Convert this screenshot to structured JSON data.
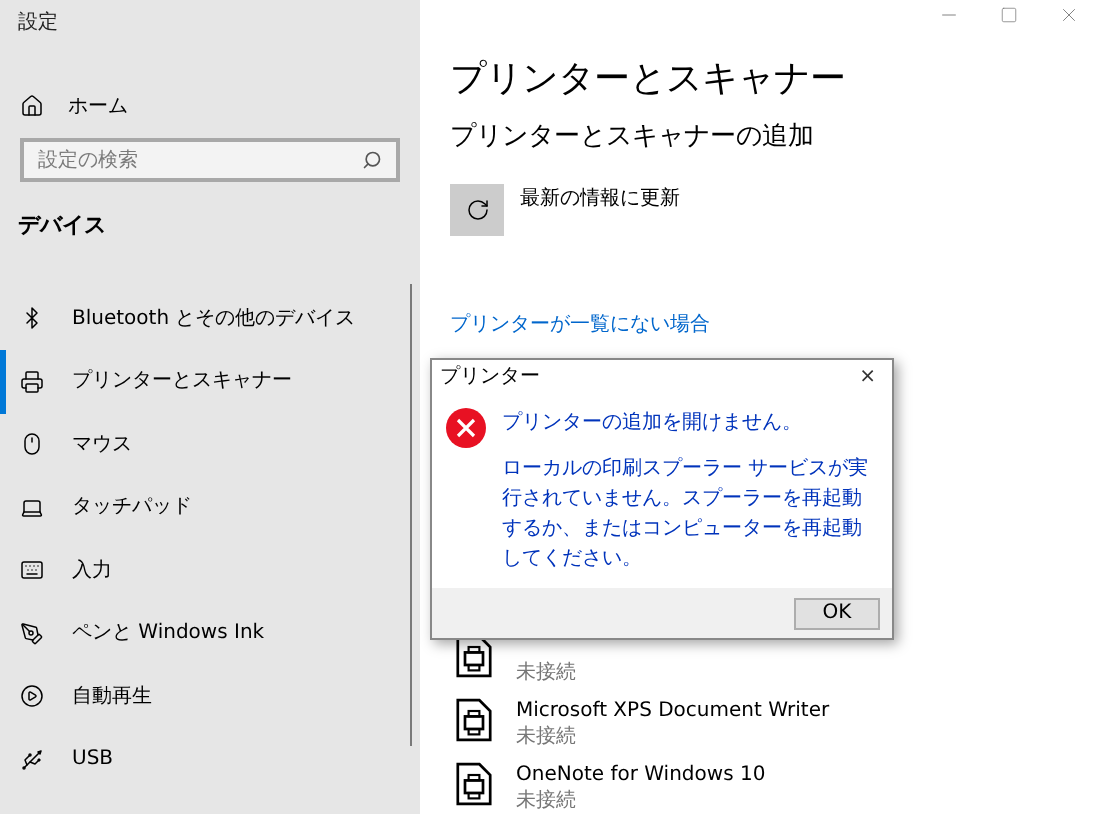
{
  "window": {
    "title": "設定"
  },
  "sidebar": {
    "home": "ホーム",
    "search": {
      "placeholder": "設定の検索"
    },
    "section": "デバイス",
    "items": [
      {
        "kind": "bluetooth",
        "label": "Bluetooth とその他のデバイス",
        "selected": false
      },
      {
        "kind": "printer",
        "label": "プリンターとスキャナー",
        "selected": true
      },
      {
        "kind": "mouse",
        "label": "マウス",
        "selected": false
      },
      {
        "kind": "touchpad",
        "label": "タッチパッド",
        "selected": false
      },
      {
        "kind": "keyboard",
        "label": "入力",
        "selected": false
      },
      {
        "kind": "pen",
        "label": "ペンと Windows Ink",
        "selected": false
      },
      {
        "kind": "autoplay",
        "label": "自動再生",
        "selected": false
      },
      {
        "kind": "usb",
        "label": "USB",
        "selected": false
      }
    ]
  },
  "main": {
    "title": "プリンターとスキャナー",
    "subtitle": "プリンターとスキャナーの追加",
    "refresh_label": "最新の情報に更新",
    "link": "プリンターが一覧にない場合",
    "devices": [
      {
        "status": "未接続"
      },
      {
        "name": "Microsoft XPS Document Writer",
        "status": "未接続"
      },
      {
        "name": "OneNote for Windows 10",
        "status": "未接続"
      }
    ]
  },
  "dialog": {
    "title": "プリンター",
    "close": "×",
    "heading": "プリンターの追加を開けません。",
    "message": "ローカルの印刷スプーラー サービスが実行されていません。スプーラーを再起動するか、またはコンピューターを再起動してください。",
    "button": "OK"
  }
}
